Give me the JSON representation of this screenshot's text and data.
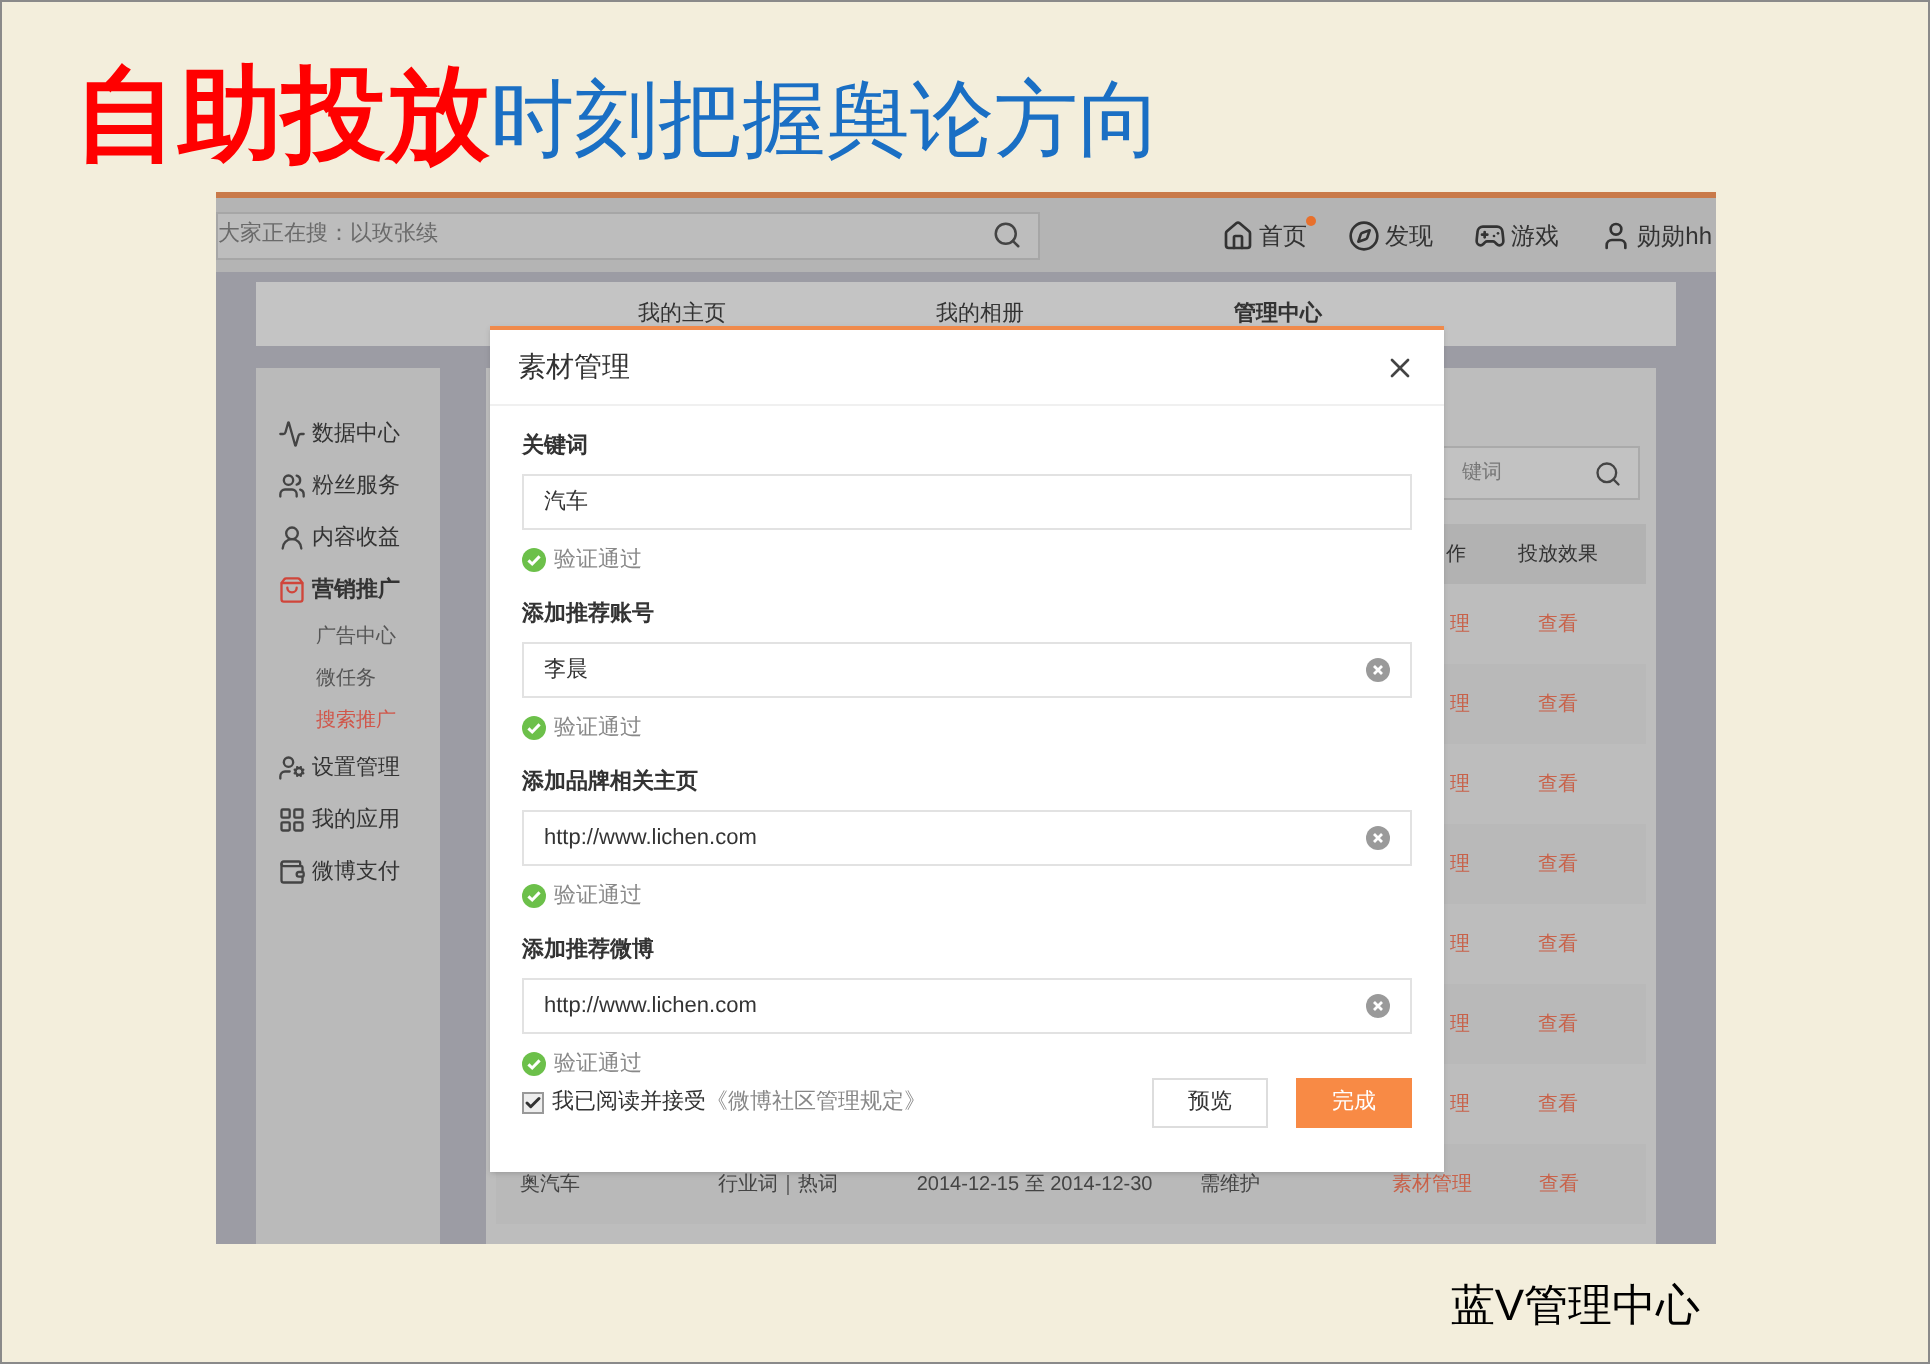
{
  "slide": {
    "title_highlight": "自助投放",
    "title_rest": "时刻把握舆论方向",
    "caption": "蓝V管理中心"
  },
  "topbar": {
    "search_placeholder": "大家正在搜：以玫张续",
    "links": [
      {
        "label": "首页",
        "kind": "home",
        "notification": true
      },
      {
        "label": "发现",
        "kind": "discover",
        "notification": false
      },
      {
        "label": "游戏",
        "kind": "game",
        "notification": false
      },
      {
        "label": "勋勋hh",
        "kind": "user",
        "notification": false
      }
    ]
  },
  "tabs": [
    {
      "label": "我的主页",
      "selected": false
    },
    {
      "label": "我的相册",
      "selected": false
    },
    {
      "label": "管理中心",
      "selected": true
    }
  ],
  "sidebar": {
    "items": [
      {
        "label": "数据中心",
        "kind": "chart",
        "expanded": false
      },
      {
        "label": "粉丝服务",
        "kind": "fans",
        "expanded": false
      },
      {
        "label": "内容收益",
        "kind": "income",
        "expanded": false
      },
      {
        "label": "营销推广",
        "kind": "bag",
        "expanded": true,
        "children": [
          {
            "label": "广告中心",
            "selected": false
          },
          {
            "label": "微任务",
            "selected": false
          },
          {
            "label": "搜索推广",
            "selected": true
          }
        ]
      },
      {
        "label": "设置管理",
        "kind": "settings",
        "expanded": false
      },
      {
        "label": "我的应用",
        "kind": "apps",
        "expanded": false
      },
      {
        "label": "微博支付",
        "kind": "wallet",
        "expanded": false
      }
    ]
  },
  "content": {
    "search_placeholder": "键词",
    "table": {
      "columns": [
        "作",
        "投放效果"
      ],
      "rows": [
        {
          "cells": [
            "理",
            "查看"
          ]
        },
        {
          "cells": [
            "理",
            "查看"
          ]
        },
        {
          "cells": [
            "理",
            "查看"
          ]
        },
        {
          "cells": [
            "理",
            "查看"
          ]
        },
        {
          "cells": [
            "理",
            "查看"
          ]
        },
        {
          "cells": [
            "理",
            "查看"
          ]
        },
        {
          "cells": [
            "理",
            "查看"
          ]
        },
        {
          "cells": [
            "奥汽车",
            "行业词｜热词",
            "2014-12-15 至 2014-12-30",
            "需维护",
            "素材管理",
            "查看"
          ]
        }
      ]
    }
  },
  "dialog": {
    "title": "素材管理",
    "fields": [
      {
        "label": "关键词",
        "value": "汽车",
        "clearable": false,
        "status": "验证通过"
      },
      {
        "label": "添加推荐账号",
        "value": "李晨",
        "clearable": true,
        "status": "验证通过"
      },
      {
        "label": "添加品牌相关主页",
        "value": "http://www.lichen.com",
        "clearable": true,
        "status": "验证通过"
      },
      {
        "label": "添加推荐微博",
        "value": "http://www.lichen.com",
        "clearable": true,
        "status": "验证通过"
      }
    ],
    "agreement": {
      "checked": true,
      "text": "我已阅读并接受",
      "link": "《微博社区管理规定》"
    },
    "buttons": [
      {
        "label": "预览",
        "kind": "secondary"
      },
      {
        "label": "完成",
        "kind": "primary"
      }
    ]
  }
}
